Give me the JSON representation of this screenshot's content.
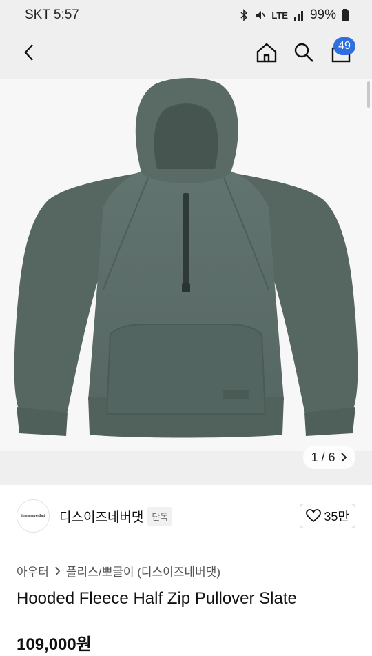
{
  "status": {
    "carrier_time": "SKT 5:57",
    "battery": "99%",
    "network": "LTE"
  },
  "header": {
    "cart_count": "49"
  },
  "gallery": {
    "counter": "1 / 6"
  },
  "seller": {
    "logo_text": "thisisneverthat",
    "name": "디스이즈네버댓",
    "exclusive": "단독",
    "likes": "35만"
  },
  "breadcrumb": {
    "level1": "아우터",
    "level2": "플리스/뽀글이 (디스이즈네버댓)"
  },
  "product": {
    "title": "Hooded Fleece Half Zip Pullover Slate",
    "price": "109,000원"
  },
  "colors": {
    "accent": "#2f6fe0",
    "garment": "#5c6d68"
  }
}
